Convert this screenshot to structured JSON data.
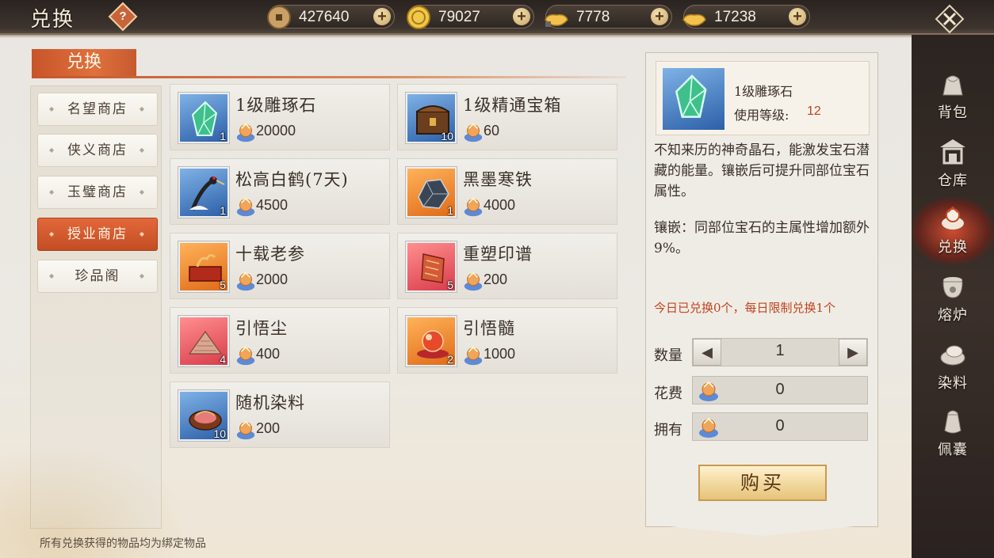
{
  "header": {
    "title": "兑换",
    "help_label": "?",
    "currencies": [
      {
        "name": "copper-coin",
        "value": "427640",
        "plus": "+"
      },
      {
        "name": "gold-coin",
        "value": "79027",
        "plus": "+"
      },
      {
        "name": "bound-ingot",
        "value": "7778",
        "plus": "+"
      },
      {
        "name": "gold-ingot",
        "value": "17238",
        "plus": "+"
      }
    ]
  },
  "section": {
    "title": "兑换"
  },
  "sidebar": {
    "items": [
      {
        "label": "名望商店"
      },
      {
        "label": "侠义商店"
      },
      {
        "label": "玉璧商店"
      },
      {
        "label": "授业商店"
      },
      {
        "label": "珍品阁"
      }
    ],
    "active_index": 3
  },
  "items": [
    {
      "name": "1级雕琢石",
      "qty": "1",
      "price": "20000",
      "thumb": "blue",
      "icon": "green-crystal-icon"
    },
    {
      "name": "1级精通宝箱",
      "qty": "10",
      "price": "60",
      "thumb": "blue",
      "icon": "treasure-chest-icon"
    },
    {
      "name": "松高白鹤(7天)",
      "qty": "1",
      "price": "4500",
      "thumb": "blue",
      "icon": "crane-icon"
    },
    {
      "name": "黑墨寒铁",
      "qty": "1",
      "price": "4000",
      "thumb": "orange",
      "icon": "iron-ore-icon"
    },
    {
      "name": "十载老参",
      "qty": "5",
      "price": "2000",
      "thumb": "orange",
      "icon": "ginseng-icon"
    },
    {
      "name": "重塑印谱",
      "qty": "5",
      "price": "200",
      "thumb": "red",
      "icon": "scroll-icon"
    },
    {
      "name": "引悟尘",
      "qty": "4",
      "price": "400",
      "thumb": "red",
      "icon": "dust-pile-icon"
    },
    {
      "name": "引悟髓",
      "qty": "2",
      "price": "1000",
      "thumb": "orange",
      "icon": "essence-orb-icon"
    },
    {
      "name": "随机染料",
      "qty": "10",
      "price": "200",
      "thumb": "blue",
      "icon": "dye-compact-icon"
    }
  ],
  "detail": {
    "name": "1级雕琢石",
    "level_label": "使用等级:",
    "level_value": "12",
    "description": "不知来历的神奇晶石，能激发宝石潜藏的能量。镶嵌后可提升同部位宝石属性。",
    "effect": "镶嵌：同部位宝石的主属性增加额外9%。",
    "limit_text": "今日已兑换0个，每日限制兑换1个",
    "quantity_label": "数量",
    "quantity_value": "1",
    "cost_label": "花费",
    "cost_value": "0",
    "own_label": "拥有",
    "own_value": "0",
    "buy_label": "购买",
    "dec_symbol": "◀",
    "inc_symbol": "▶"
  },
  "nav": [
    {
      "label": "背包",
      "icon": "bag-icon"
    },
    {
      "label": "仓库",
      "icon": "warehouse-icon"
    },
    {
      "label": "兑换",
      "icon": "exchange-icon"
    },
    {
      "label": "熔炉",
      "icon": "furnace-icon"
    },
    {
      "label": "染料",
      "icon": "dye-icon"
    },
    {
      "label": "佩囊",
      "icon": "pouch-icon"
    }
  ],
  "footer_note": "所有兑换获得的物品均为绑定物品",
  "colors": {
    "accent": "#d4602f",
    "price_highlight": "#b8441e",
    "limit_text": "#c0441c"
  }
}
